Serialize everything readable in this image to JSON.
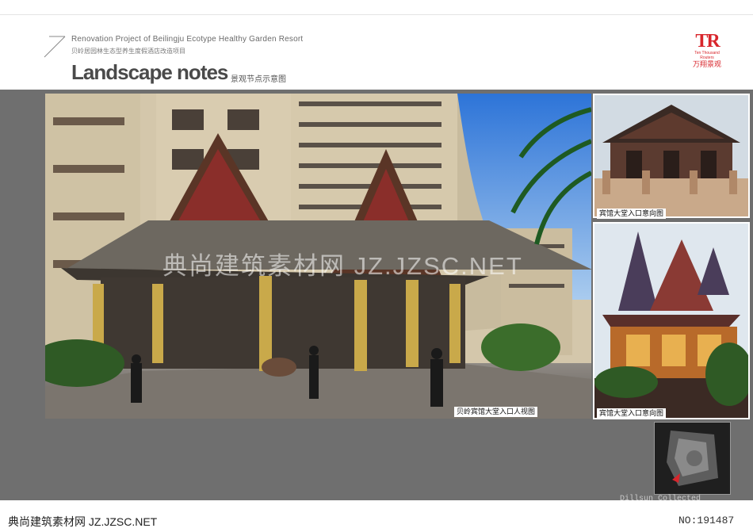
{
  "header": {
    "project_en": "Renovation Project of Beilingju Ecotype Healthy Garden Resort",
    "project_cn": "贝岭居园林生态型养生度假酒店改造项目",
    "title": "Landscape notes",
    "subtitle": "景观节点示意图"
  },
  "logo": {
    "mark": "TR",
    "small": "Ten Thousand Routers",
    "cn": "万翔景观",
    "color": "#d8262c"
  },
  "images": {
    "main_caption": "贝岭宾馆大堂入口人视图",
    "thumb1_caption": "宾馆大堂入口意向图",
    "thumb2_caption": "宾馆大堂入口意向图"
  },
  "watermark": "典尚建筑素材网 JZ.JZSC.NET",
  "signature": "Dillsun Collected",
  "footer": {
    "left": "典尚建筑素材网 JZ.JZSC.NET",
    "right": "NO:191487"
  },
  "colors": {
    "panel": "#6f6f6f",
    "accent_red": "#d8262c"
  }
}
